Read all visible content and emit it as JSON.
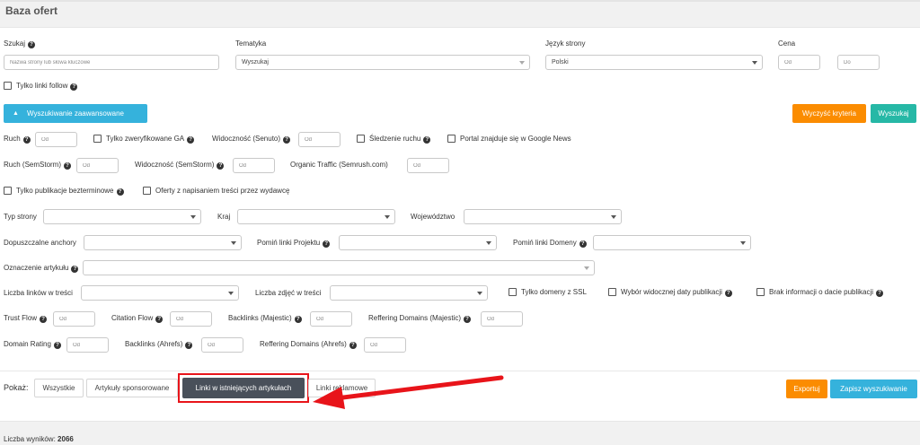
{
  "page": {
    "title": "Baza ofert"
  },
  "search": {
    "label": "Szukaj",
    "placeholder": "Nazwa strony lub słowa kluczowe",
    "topic_label": "Tematyka",
    "topic_value": "Wyszukaj",
    "lang_label": "Język strony",
    "lang_value": "Polski",
    "price_label": "Cena",
    "price_from_ph": "Od",
    "price_to_ph": "Do",
    "follow_only": "Tylko linki follow"
  },
  "buttons": {
    "advanced": "Wyszukiwanie zaawansowane",
    "clear": "Wyczyść kryteria",
    "search": "Wyszukaj",
    "export": "Exportuj",
    "save_search": "Zapisz wyszukiwanie"
  },
  "advanced": {
    "traffic": "Ruch",
    "verified_ga": "Tylko zweryfikowane GA",
    "vis_senuto": "Widoczność (Senuto)",
    "tracking": "Śledzenie ruchu",
    "google_news": "Portal znajduje się w Google News",
    "traffic_semstorm": "Ruch (SemStorm)",
    "vis_semstorm": "Widoczność (SemStorm)",
    "organic_traffic": "Organic Traffic (Semrush.com)",
    "perpetual": "Tylko publikacje bezterminowe",
    "publisher_writes": "Oferty z napisaniem treści przez wydawcę",
    "site_type": "Typ strony",
    "country": "Kraj",
    "voivodeship": "Województwo",
    "anchors": "Dopuszczalne anchory",
    "skip_project": "Pomiń linki Projektu",
    "skip_domains": "Pomiń linki Domeny",
    "article_marking": "Oznaczenie artykułu",
    "links_count": "Liczba linków w treści",
    "images_count": "Liczba zdjęć w treści",
    "ssl_only": "Tylko domeny z SSL",
    "pub_date_choice": "Wybór widocznej daty publikacji",
    "no_pub_date": "Brak informacji o dacie publikacji",
    "trust_flow": "Trust Flow",
    "citation_flow": "Citation Flow",
    "backlinks_majestic": "Backlinks (Majestic)",
    "ref_domains_majestic": "Reffering Domains (Majestic)",
    "domain_rating": "Domain Rating",
    "backlinks_ahrefs": "Backlinks (Ahrefs)",
    "ref_domains_ahrefs": "Reffering Domains (Ahrefs)",
    "from_ph": "Od"
  },
  "show": {
    "label": "Pokaż:",
    "tabs": [
      "Wszystkie",
      "Artykuły sponsorowane",
      "Linki w istniejących artykułach",
      "Linki reklamowe"
    ],
    "active_index": 2
  },
  "results": {
    "label": "Liczba wyników:",
    "count": "2066"
  },
  "colors": {
    "orange": "#fb8c00",
    "teal": "#26b8a6",
    "blue": "#35b2dc",
    "active_tab": "#49505a",
    "annotation_red": "#e8141a"
  }
}
